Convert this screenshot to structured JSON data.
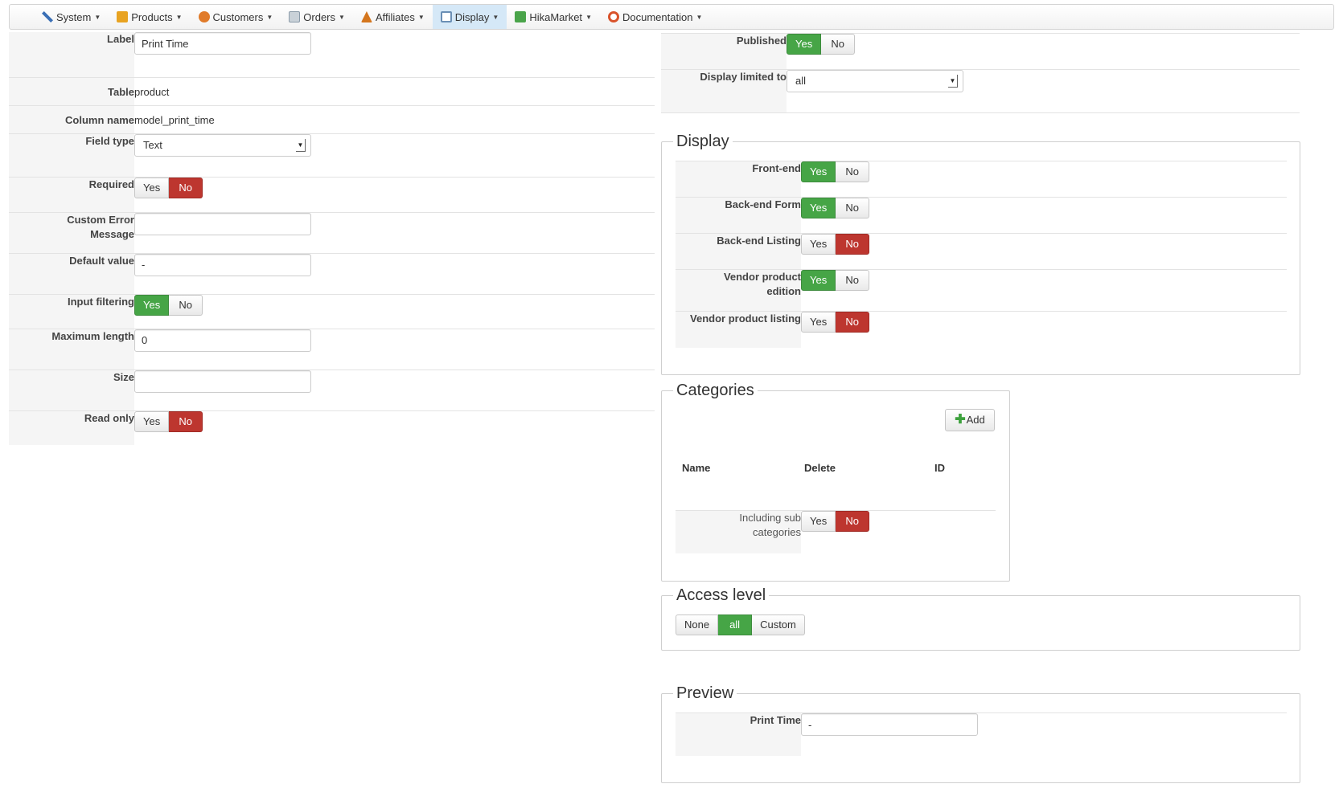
{
  "menu": {
    "items": [
      {
        "label": "System",
        "icon": "tools-icon",
        "color": "#3a6fb5"
      },
      {
        "label": "Products",
        "icon": "products-icon",
        "color": "#e8a321"
      },
      {
        "label": "Customers",
        "icon": "customers-icon",
        "color": "#e07b2a"
      },
      {
        "label": "Orders",
        "icon": "orders-icon",
        "color": "#8a9aa8"
      },
      {
        "label": "Affiliates",
        "icon": "affiliates-icon",
        "color": "#d4761e"
      },
      {
        "label": "Display",
        "icon": "display-icon",
        "color": "#6a8fb5"
      },
      {
        "label": "HikaMarket",
        "icon": "hikamarket-icon",
        "color": "#4aa44a"
      },
      {
        "label": "Documentation",
        "icon": "documentation-icon",
        "color": "#d9532b"
      }
    ],
    "active": "Display"
  },
  "left": {
    "label": {
      "key": "Label",
      "value": "Print Time"
    },
    "table": {
      "key": "Table",
      "value": "product"
    },
    "column_name": {
      "key": "Column name",
      "value": "model_print_time"
    },
    "field_type": {
      "key": "Field type",
      "value": "Text"
    },
    "required": {
      "key": "Required",
      "yes": "Yes",
      "no": "No",
      "selected": "No"
    },
    "custom_error": {
      "key_line1": "Custom Error",
      "key_line2": "Message",
      "value": ""
    },
    "default_value": {
      "key": "Default value",
      "value": "-"
    },
    "input_filtering": {
      "key": "Input filtering",
      "yes": "Yes",
      "no": "No",
      "selected": "Yes"
    },
    "maximum_length": {
      "key": "Maximum length",
      "value": "0"
    },
    "size": {
      "key": "Size",
      "value": ""
    },
    "read_only": {
      "key": "Read only",
      "yes": "Yes",
      "no": "No",
      "selected": "No"
    }
  },
  "right_top": {
    "published": {
      "key": "Published",
      "yes": "Yes",
      "no": "No",
      "selected": "Yes"
    },
    "display_limited": {
      "key": "Display limited to",
      "value": "all"
    }
  },
  "display": {
    "legend": "Display",
    "front_end": {
      "key": "Front-end",
      "selected": "Yes"
    },
    "backend_form": {
      "key": "Back-end Form",
      "selected": "Yes"
    },
    "backend_listing": {
      "key": "Back-end Listing",
      "selected": "No"
    },
    "vendor_edition": {
      "key_line1": "Vendor product",
      "key_line2": "edition",
      "selected": "Yes"
    },
    "vendor_listing": {
      "key": "Vendor product listing",
      "selected": "No"
    },
    "yes": "Yes",
    "no": "No"
  },
  "categories": {
    "legend": "Categories",
    "add_label": "Add",
    "columns": {
      "name": "Name",
      "delete": "Delete",
      "id": "ID"
    },
    "including": {
      "key_line1": "Including sub",
      "key_line2": "categories",
      "yes": "Yes",
      "no": "No",
      "selected": "No"
    }
  },
  "access": {
    "legend": "Access level",
    "options": [
      "None",
      "all",
      "Custom"
    ],
    "selected": "all"
  },
  "preview": {
    "legend": "Preview",
    "key": "Print Time",
    "value": "-"
  },
  "colors": {
    "green": "#46a546",
    "red": "#bd362f",
    "menu_active": "#d5e8f7"
  }
}
